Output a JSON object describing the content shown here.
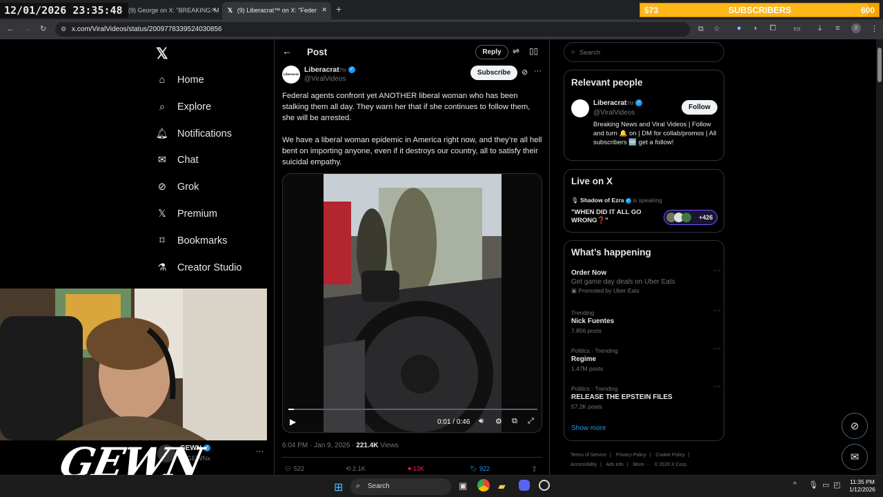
{
  "overlay": {
    "clock": "12/01/2026 23:35:48"
  },
  "subscribers": {
    "current": "573",
    "label": "SUBSCRIBERS",
    "goal": "600",
    "progress_fraction": 0.955
  },
  "browser": {
    "tabs": [
      {
        "title": "(9) George on X: \"BREAKING: M"
      },
      {
        "title": "(9) Liberacrat™ on X: \"Feder"
      }
    ],
    "new_tab": "+",
    "url": "x.com/ViralVideos/status/2009778339524030856"
  },
  "nav": {
    "logo": "X",
    "items": [
      {
        "label": "Home",
        "icon": "home-icon"
      },
      {
        "label": "Explore",
        "icon": "search-icon"
      },
      {
        "label": "Notifications",
        "icon": "bell-icon"
      },
      {
        "label": "Chat",
        "icon": "mail-icon"
      },
      {
        "label": "Grok",
        "icon": "grok-icon"
      },
      {
        "label": "Premium",
        "icon": "x-icon"
      },
      {
        "label": "Bookmarks",
        "icon": "bookmark-icon"
      },
      {
        "label": "Creator Studio",
        "icon": "flask-icon"
      }
    ]
  },
  "post": {
    "header_title": "Post",
    "reply_label": "Reply",
    "author_name": "Liberacrat",
    "author_tm": "TM",
    "author_handle": "@ViralVideos",
    "avatar_text": "Liberacrat",
    "subscribe_label": "Subscribe",
    "text_p1": "Federal agents confront yet ANOTHER liberal woman who has been stalking them all day. They warn her that if she continues to follow them, she will be arrested.",
    "text_p2": "We have a liberal woman epidemic in America right now, and they’re all hell bent on importing anyone, even if it destroys our country, all to satisfy their suicidal empathy.",
    "video_time": "0:01 / 0:46",
    "video_progress_fraction": 0.022,
    "meta_time": "6:04 PM · Jan 9, 2026 · ",
    "views_count": "221.4K",
    "views_label": " Views",
    "stats": {
      "replies": "522",
      "reposts": "2.1K",
      "likes": "13K",
      "bookmarks": "922"
    }
  },
  "sidebar": {
    "search_placeholder": "Search",
    "relevant": {
      "title": "Relevant people",
      "name": "Liberacrat",
      "tm": "TM",
      "handle": "@ViralVideos",
      "follow_label": "Follow",
      "bio": "Breaking News and Viral Videos | Follow and turn 🔔 on | DM for collab/promos | All subscribers 🆓 get a follow!"
    },
    "live": {
      "title": "Live on X",
      "host": "Shadow of Ezra",
      "speaking": "is speaking",
      "space_title": "\"WHEN DID IT ALL GO WRONG❓\"",
      "listeners": "+426"
    },
    "happening": {
      "title": "What’s happening",
      "items": [
        {
          "title": "Order Now",
          "sub": "Get game day deals on Uber Eats",
          "meta": "Promoted by Uber Eats"
        },
        {
          "context": "Trending",
          "title": "Nick Fuentes",
          "meta": "7,856 posts"
        },
        {
          "context": "Politics · Trending",
          "title": "Regime",
          "meta": "1.47M posts"
        },
        {
          "context": "Politics · Trending",
          "title": "RELEASE THE EPSTEIN FILES",
          "meta": "57.2K posts"
        }
      ],
      "show_more": "Show more"
    },
    "footer": {
      "links": [
        "Terms of Service",
        "Privacy Policy",
        "Cookie Policy",
        "Accessibility",
        "Ads info",
        "More ···"
      ],
      "copyright": "© 2026 X Corp."
    }
  },
  "account": {
    "name": "GEWN",
    "handle": "@GEWNx"
  },
  "watermark": "GEWN",
  "taskbar": {
    "search_placeholder": "Search",
    "time": "11:35 PM",
    "date": "1/12/2026"
  },
  "colors": {
    "accent": "#1d9bf0",
    "like": "#f91880",
    "subs_bar": "#f5a400"
  }
}
